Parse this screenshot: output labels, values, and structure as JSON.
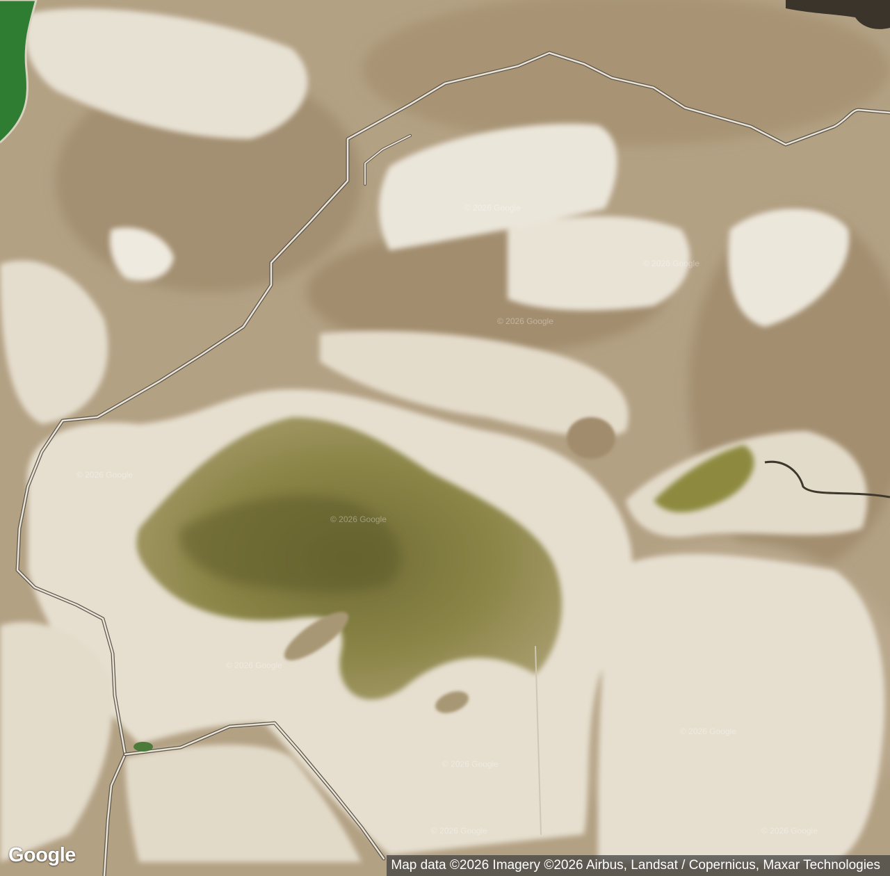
{
  "map": {
    "type": "satellite",
    "watermark": "© 2026 Google",
    "logo": "Google",
    "attribution": "Map data ©2026 Imagery ©2026 Airbus, Landsat / Copernicus, Maxar Technologies",
    "colors": {
      "base": "#b8a68a",
      "salt_flat": "#ece6d8",
      "vegetation": "#7d7a3e",
      "water": "#2e7d32",
      "road": "#e9e4da",
      "road_edge": "#5d5547"
    }
  }
}
